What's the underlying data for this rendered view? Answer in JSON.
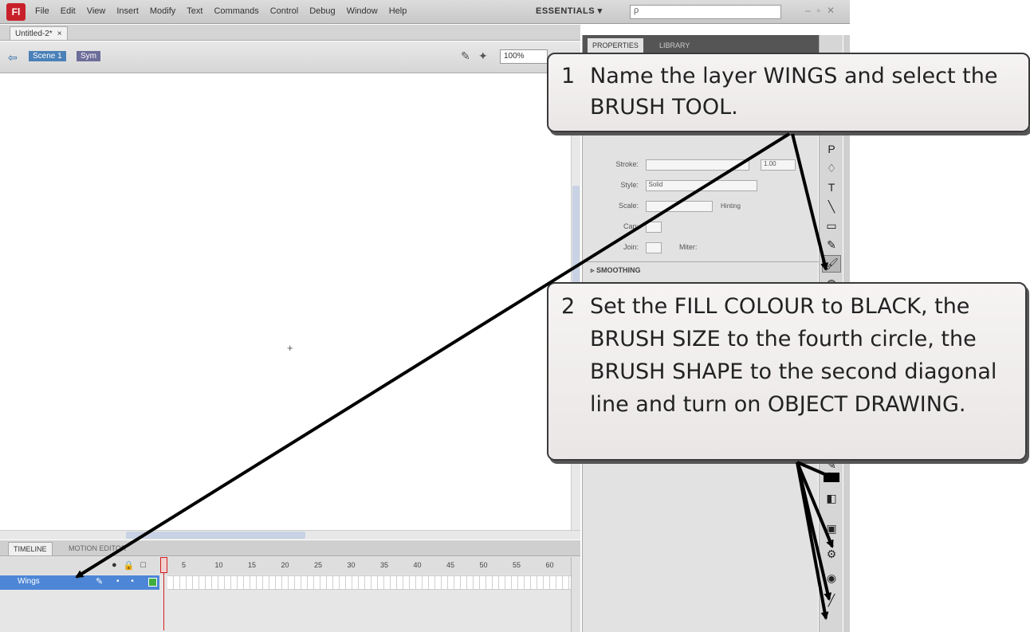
{
  "app": {
    "logo_text": "Fl",
    "menu": [
      "File",
      "Edit",
      "View",
      "Insert",
      "Modify",
      "Text",
      "Commands",
      "Control",
      "Debug",
      "Window",
      "Help"
    ],
    "workspace": "ESSENTIALS ▾",
    "search_placeholder": "ρ",
    "window_controls": [
      "–",
      "▫",
      "✕"
    ]
  },
  "document": {
    "tab_label": "Untitled-2*",
    "tab_close": "×",
    "scene_label": "Scene 1",
    "symbol_label": "Sym",
    "zoom": "100%"
  },
  "timeline": {
    "tabs": [
      "TIMELINE",
      "MOTION EDITOR"
    ],
    "header_icons": [
      "●",
      "🔒",
      "□"
    ],
    "frame_numbers": [
      "5",
      "10",
      "15",
      "20",
      "25",
      "30",
      "35",
      "40",
      "45",
      "50",
      "55",
      "60"
    ],
    "layer": {
      "name": "Wings",
      "pencil": "✎",
      "dots": "• •"
    }
  },
  "properties": {
    "tabs": [
      "PROPERTIES",
      "LIBRARY"
    ],
    "rows": [
      {
        "label": "Stroke:",
        "value": "1.00"
      },
      {
        "label": "Style:",
        "value": "Solid"
      },
      {
        "label": "Scale:",
        "value": "Hinting"
      },
      {
        "label": "Cap:",
        "value": ""
      },
      {
        "label": "Join:",
        "value": "Miter:"
      }
    ],
    "section_smoothing": "▹ SMOOTHING"
  },
  "tools": [
    "↖",
    "⬚",
    "⌖",
    "P",
    "♢",
    "T",
    "╲",
    "▭",
    "✎",
    "🖌",
    "◍",
    "⚲",
    "✋",
    "🔍",
    "✎",
    "◧",
    "▣",
    "⚙",
    "◉",
    "╱"
  ],
  "callouts": {
    "step1_num": "1",
    "step1_text": "Name the layer WINGS and select the BRUSH TOOL.",
    "step2_num": "2",
    "step2_text": "Set the FILL COLOUR to BLACK, the BRUSH SIZE to the fourth circle, the BRUSH SHAPE to the second diagonal line and turn on OBJECT DRAWING."
  }
}
